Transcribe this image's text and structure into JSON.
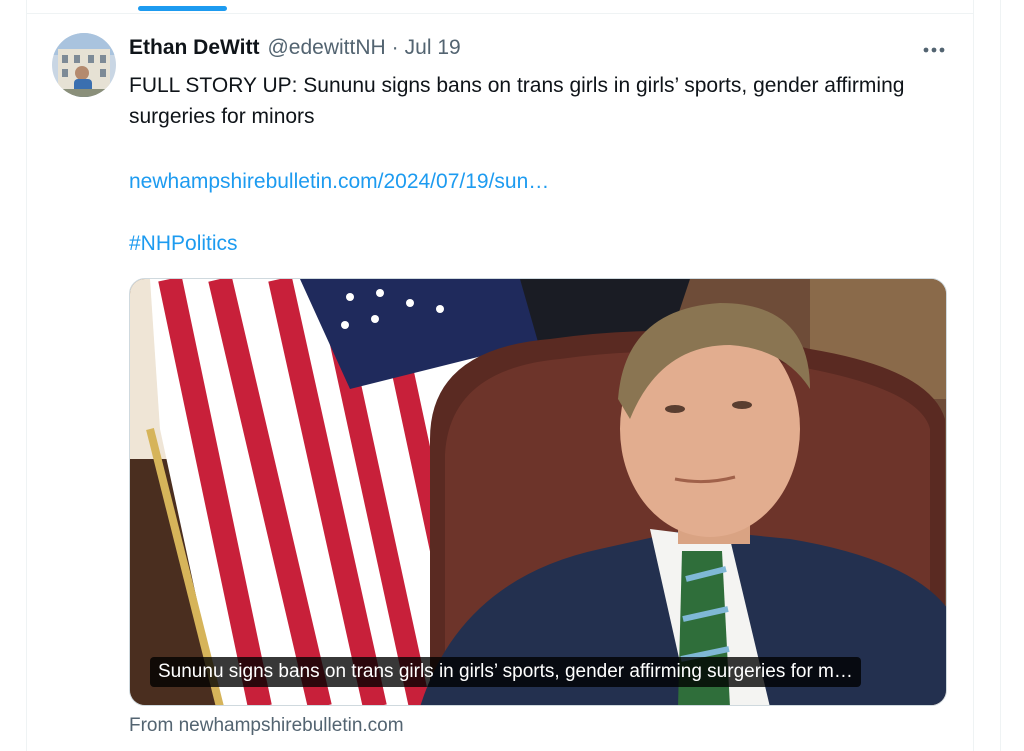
{
  "tweet": {
    "author_name": "Ethan DeWitt",
    "author_handle": "@edewittNH",
    "separator": "·",
    "date": "Jul 19",
    "text": "FULL STORY UP: Sununu signs bans on trans girls in girls’ sports, gender affirming surgeries for minors",
    "link_text": "newhampshirebulletin.com/2024/07/19/sun…",
    "hashtag": "#NHPolitics"
  },
  "card": {
    "caption": "Sununu signs bans on trans girls in girls’ sports, gender affirming surgeries for m…",
    "source": "From newhampshirebulletin.com"
  },
  "icons": {
    "more": "more-horizontal-icon",
    "avatar": "profile-photo"
  },
  "colors": {
    "accent": "#1d9bf0",
    "text_primary": "#0f1419",
    "text_secondary": "#536471",
    "border": "#eff3f4"
  }
}
